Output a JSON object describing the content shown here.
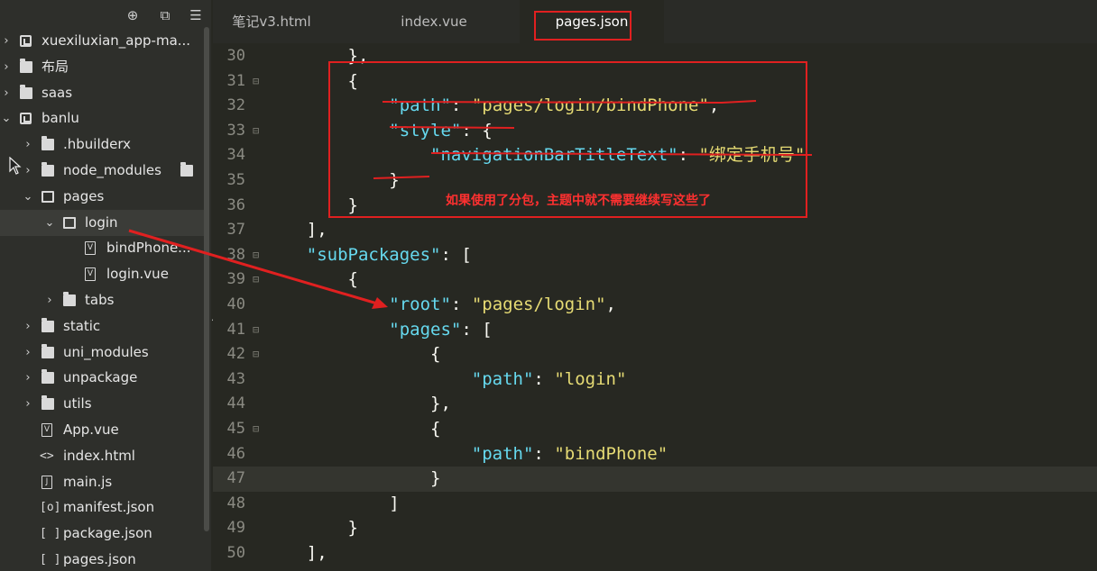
{
  "sidebar": {
    "toolbar": [
      "target-icon",
      "copy-icon",
      "menu-icon"
    ],
    "tree": [
      {
        "label": "xuexiluxian_app-ma...",
        "type": "project",
        "depth": 0,
        "chevron": "›"
      },
      {
        "label": "布局",
        "type": "folder",
        "depth": 0,
        "chevron": "›"
      },
      {
        "label": "saas",
        "type": "folder",
        "depth": 0,
        "chevron": "›"
      },
      {
        "label": "banlu",
        "type": "project",
        "depth": 0,
        "chevron": "⌄"
      },
      {
        "label": ".hbuilderx",
        "type": "folder",
        "depth": 1,
        "chevron": "›"
      },
      {
        "label": "node_modules",
        "type": "folder",
        "depth": 1,
        "chevron": "›"
      },
      {
        "label": "pages",
        "type": "folder-open",
        "depth": 1,
        "chevron": "⌄"
      },
      {
        "label": "login",
        "type": "folder-open",
        "depth": 2,
        "chevron": "⌄"
      },
      {
        "label": "bindPhone...",
        "type": "vue",
        "depth": 3
      },
      {
        "label": "login.vue",
        "type": "vue",
        "depth": 3
      },
      {
        "label": "tabs",
        "type": "folder",
        "depth": 2,
        "chevron": "›"
      },
      {
        "label": "static",
        "type": "folder",
        "depth": 1,
        "chevron": "›"
      },
      {
        "label": "uni_modules",
        "type": "folder",
        "depth": 1,
        "chevron": "›"
      },
      {
        "label": "unpackage",
        "type": "folder",
        "depth": 1,
        "chevron": "›"
      },
      {
        "label": "utils",
        "type": "folder",
        "depth": 1,
        "chevron": "›"
      },
      {
        "label": "App.vue",
        "type": "vue",
        "depth": 1
      },
      {
        "label": "index.html",
        "type": "html",
        "depth": 1,
        "glyph": "<>"
      },
      {
        "label": "main.js",
        "type": "js",
        "depth": 1
      },
      {
        "label": "manifest.json",
        "type": "manifest",
        "depth": 1,
        "glyph": "[o]"
      },
      {
        "label": "package.json",
        "type": "json",
        "depth": 1,
        "glyph": "[ ]"
      },
      {
        "label": "pages.json",
        "type": "json",
        "depth": 1,
        "glyph": "[ ]"
      }
    ]
  },
  "tabs": [
    {
      "label": "笔记v3.html"
    },
    {
      "label": "index.vue"
    },
    {
      "label": "pages.json",
      "active": true
    }
  ],
  "editor": {
    "lines": [
      {
        "n": "30",
        "fold": "",
        "tokens": [
          [
            "p",
            "        },"
          ]
        ]
      },
      {
        "n": "31",
        "fold": "⊟",
        "tokens": [
          [
            "p",
            "        {"
          ]
        ]
      },
      {
        "n": "32",
        "fold": "",
        "tokens": [
          [
            "p",
            "            "
          ],
          [
            "k",
            "\"path\""
          ],
          [
            "p",
            ": "
          ],
          [
            "s",
            "\"pages/login/bindPhone\""
          ],
          [
            "p",
            ","
          ]
        ]
      },
      {
        "n": "33",
        "fold": "⊟",
        "tokens": [
          [
            "p",
            "            "
          ],
          [
            "k",
            "\"style\""
          ],
          [
            "p",
            ": {"
          ]
        ]
      },
      {
        "n": "34",
        "fold": "",
        "tokens": [
          [
            "p",
            "                "
          ],
          [
            "k",
            "\"navigationBarTitleText\""
          ],
          [
            "p",
            ": "
          ],
          [
            "s",
            "\"绑定手机号\""
          ]
        ]
      },
      {
        "n": "35",
        "fold": "",
        "tokens": [
          [
            "p",
            "            }"
          ]
        ]
      },
      {
        "n": "36",
        "fold": "",
        "tokens": [
          [
            "p",
            "        }"
          ]
        ]
      },
      {
        "n": "37",
        "fold": "",
        "tokens": [
          [
            "p",
            "    ],"
          ]
        ]
      },
      {
        "n": "38",
        "fold": "⊟",
        "tokens": [
          [
            "p",
            "    "
          ],
          [
            "k",
            "\"subPackages\""
          ],
          [
            "p",
            ": ["
          ]
        ]
      },
      {
        "n": "39",
        "fold": "⊟",
        "tokens": [
          [
            "p",
            "        {"
          ]
        ]
      },
      {
        "n": "40",
        "fold": "",
        "tokens": [
          [
            "p",
            "            "
          ],
          [
            "k",
            "\"root\""
          ],
          [
            "p",
            ": "
          ],
          [
            "s",
            "\"pages/login\""
          ],
          [
            "p",
            ","
          ]
        ]
      },
      {
        "n": "41",
        "fold": "⊟",
        "tokens": [
          [
            "p",
            "            "
          ],
          [
            "k",
            "\"pages\""
          ],
          [
            "p",
            ": ["
          ]
        ]
      },
      {
        "n": "42",
        "fold": "⊟",
        "tokens": [
          [
            "p",
            "                {"
          ]
        ]
      },
      {
        "n": "43",
        "fold": "",
        "tokens": [
          [
            "p",
            "                    "
          ],
          [
            "k",
            "\"path\""
          ],
          [
            "p",
            ": "
          ],
          [
            "s",
            "\"login\""
          ]
        ]
      },
      {
        "n": "44",
        "fold": "",
        "tokens": [
          [
            "p",
            "                },"
          ]
        ]
      },
      {
        "n": "45",
        "fold": "⊟",
        "tokens": [
          [
            "p",
            "                {"
          ]
        ]
      },
      {
        "n": "46",
        "fold": "",
        "tokens": [
          [
            "p",
            "                    "
          ],
          [
            "k",
            "\"path\""
          ],
          [
            "p",
            ": "
          ],
          [
            "s",
            "\"bindPhone\""
          ]
        ]
      },
      {
        "n": "47",
        "fold": "",
        "tokens": [
          [
            "p",
            "                }"
          ]
        ],
        "current": true
      },
      {
        "n": "48",
        "fold": "",
        "tokens": [
          [
            "p",
            "            ]"
          ]
        ]
      },
      {
        "n": "49",
        "fold": "",
        "tokens": [
          [
            "p",
            "        }"
          ]
        ]
      },
      {
        "n": "50",
        "fold": "",
        "tokens": [
          [
            "p",
            "    ],"
          ]
        ]
      }
    ]
  },
  "annotation": {
    "note": "如果使用了分包，主题中就不需要继续写这些了",
    "color": "#e02020"
  },
  "colors": {
    "key": "#66d9ef",
    "string": "#e6db74",
    "punct": "#f8f8f2",
    "bg": "#272822"
  }
}
